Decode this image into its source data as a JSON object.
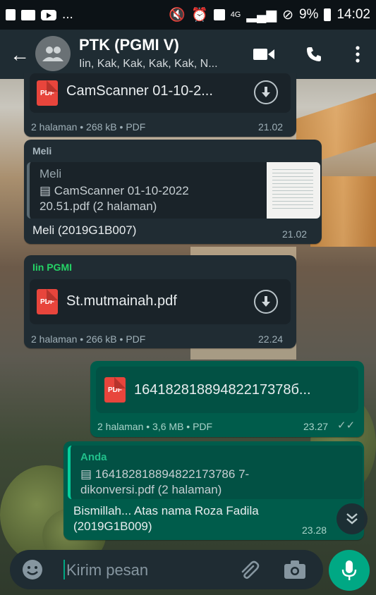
{
  "status_bar": {
    "left_ellipsis": "...",
    "net": "4G",
    "battery": "9%",
    "clock": "14:02"
  },
  "header": {
    "title": "PTK (PGMI V)",
    "subtitle": "Iin, Kak, Kak, Kak, Kak, N..."
  },
  "messages": [
    {
      "file": "CamScanner 01-10-2...",
      "meta": "2 halaman • 268 kB • PDF",
      "time": "21.02"
    },
    {
      "sender": "Meli",
      "quote_author": "Meli",
      "quote_text_1": "CamScanner 01-10-2022",
      "quote_text_2": "20.51.pdf (2 halaman)",
      "text": "Meli (2019G1B007)",
      "time": "21.02"
    },
    {
      "sender": "Iin PGMI",
      "file": "St.mutmainah.pdf",
      "meta": "2 halaman • 266 kB • PDF",
      "time": "22.24"
    },
    {
      "file": "16418281889482217378б...",
      "meta": "2 halaman • 3,6 MB • PDF",
      "time": "23.27"
    },
    {
      "quote_author": "Anda",
      "quote_text_1": "164182818894822173786 7-",
      "quote_text_2": "dikonversi.pdf (2 halaman)",
      "text_1": "Bismillah... Atas nama Roza Fadila",
      "text_2": "(2019G1B009)",
      "time": "23.28"
    }
  ],
  "pdf_badge": "PDF",
  "input": {
    "placeholder": "Kirim pesan"
  },
  "colors": {
    "header": "#1f2c33",
    "incoming": "#202c33",
    "outgoing": "#005c4b",
    "accent": "#00a884",
    "sender_green": "#25d366"
  }
}
